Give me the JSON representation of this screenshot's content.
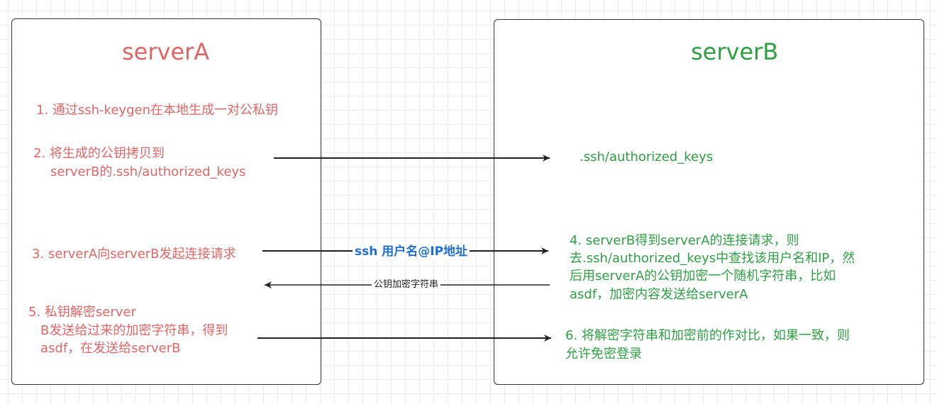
{
  "server_a": {
    "title": "serverA",
    "steps": {
      "step1": "1. 通过ssh-keygen在本地生成一对公私钥",
      "step2_line1": "2. 将生成的公钥拷贝到",
      "step2_line2": "serverB的.ssh/authorized_keys",
      "step3": "3. serverA向serverB发起连接请求",
      "step5_line1": "5. 私钥解密server",
      "step5_line2": "B发送给过来的加密字符串，得到",
      "step5_line3": "asdf，在发送给serverB"
    }
  },
  "server_b": {
    "title": "serverB",
    "steps": {
      "keys_file": ".ssh/authorized_keys",
      "step4_line1": "4. serverB得到serverA的连接请求，则",
      "step4_line2": "去.ssh/authorized_keys中查找该用户名和IP，然",
      "step4_line3": "后用serverA的公钥加密一个随机字符串，比如",
      "step4_line4": "asdf，加密内容发送给serverA",
      "step6_line1": "6.  将解密字符串和加密前的作对比，如果一致，则",
      "step6_line2": "允许免密登录"
    }
  },
  "arrows": {
    "ssh_label": "ssh 用户名@IP地址",
    "encrypted_label": "公钥加密字符串"
  },
  "colors": {
    "server_a_text": "#e06666",
    "server_b_text": "#2ea043",
    "ssh_label": "#1f6fd1",
    "arrow": "#222222"
  }
}
